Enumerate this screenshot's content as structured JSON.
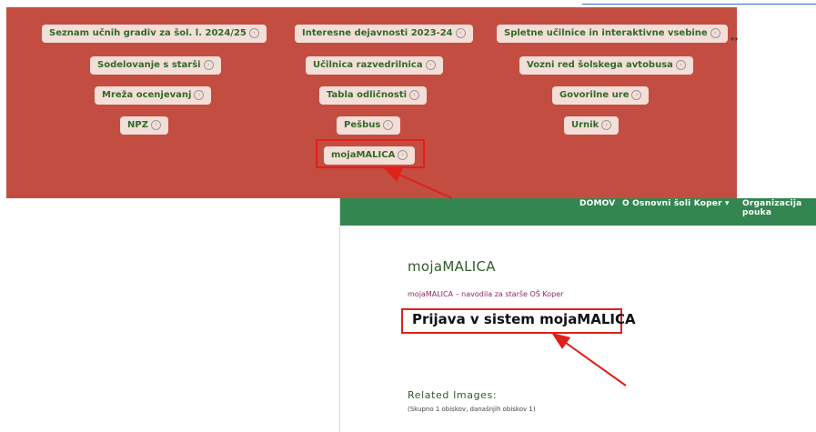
{
  "banner": {
    "col1": [
      "Seznam učnih gradiv za šol. l. 2024/25",
      "Sodelovanje s starši",
      "Mreža ocenjevanj",
      "NPZ"
    ],
    "col2": [
      "Interesne dejavnosti 2023-24",
      "Učilnica razvedrilnica",
      "Tabla odličnosti",
      "Pešbus",
      "mojaMALICA"
    ],
    "col3": [
      "Spletne učilnice in interaktivne vsebine",
      "Vozni red šolskega avtobusa",
      "Govorilne ure",
      "Urnik"
    ],
    "chevron": "›"
  },
  "nav": {
    "items": [
      "DOMOV",
      "O Osnovni šoli Koper ▾",
      "Organizacija pouka"
    ]
  },
  "page": {
    "title": "mojaMALICA",
    "breadcrumb": "mojaMALICA – navodila za starše OŠ Koper",
    "heading": "Prijava v sistem mojaMALICA",
    "related_title": "Related Images:",
    "visits": "(Skupno 1 obiskov, današnjih obiskov 1)"
  },
  "colors": {
    "banner_bg": "#c44d42",
    "pill_bg": "#f4ded8",
    "pill_text": "#2f6b2a",
    "nav_bg": "#338650",
    "highlight": "#e0201b"
  },
  "icons": [
    "resize-cursor-icon",
    "chevron-right-circle-icon"
  ]
}
